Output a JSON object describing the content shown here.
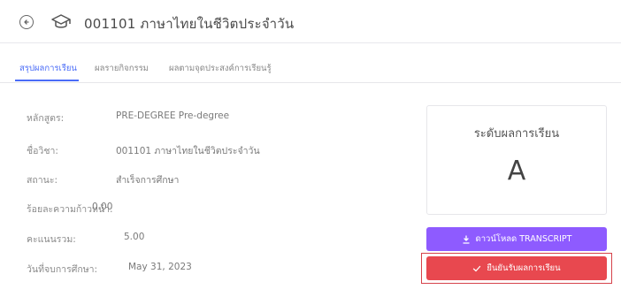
{
  "header": {
    "title": "001101 ภาษาไทยในชีวิตประจำวัน",
    "back_icon": "back-arrow-circle-icon",
    "course_icon": "graduation-cap-icon"
  },
  "tabs": [
    {
      "label": "สรุปผลการเรียน",
      "active": true
    },
    {
      "label": "ผลรายกิจกรรม",
      "active": false
    },
    {
      "label": "ผลตามจุดประสงค์การเรียนรู้",
      "active": false
    }
  ],
  "info": {
    "curriculum_label": "หลักสูตร:",
    "curriculum_value": "PRE-DEGREE Pre-degree",
    "subject_label": "ชื่อวิชา:",
    "subject_value": "001101 ภาษาไทยในชีวิตประจำวัน",
    "status_label": "สถานะ:",
    "status_value": "สำเร็จการศึกษา",
    "progress_label": "ร้อยละความก้าวหน้า:",
    "progress_value": "0.00",
    "score_label": "คะแนนรวม:",
    "score_value": "5.00",
    "date_label": "วันที่จบการศึกษา:",
    "date_value": "May 31, 2023"
  },
  "grade": {
    "label": "ระดับผลการเรียน",
    "value": "A"
  },
  "buttons": {
    "download_label": "ดาวน์โหลด TRANSCRIPT",
    "confirm_label": "ยืนยันรับผลการเรียน"
  },
  "colors": {
    "accent": "#4a6cf7",
    "download": "#8e5bff",
    "confirm": "#e8484f"
  }
}
